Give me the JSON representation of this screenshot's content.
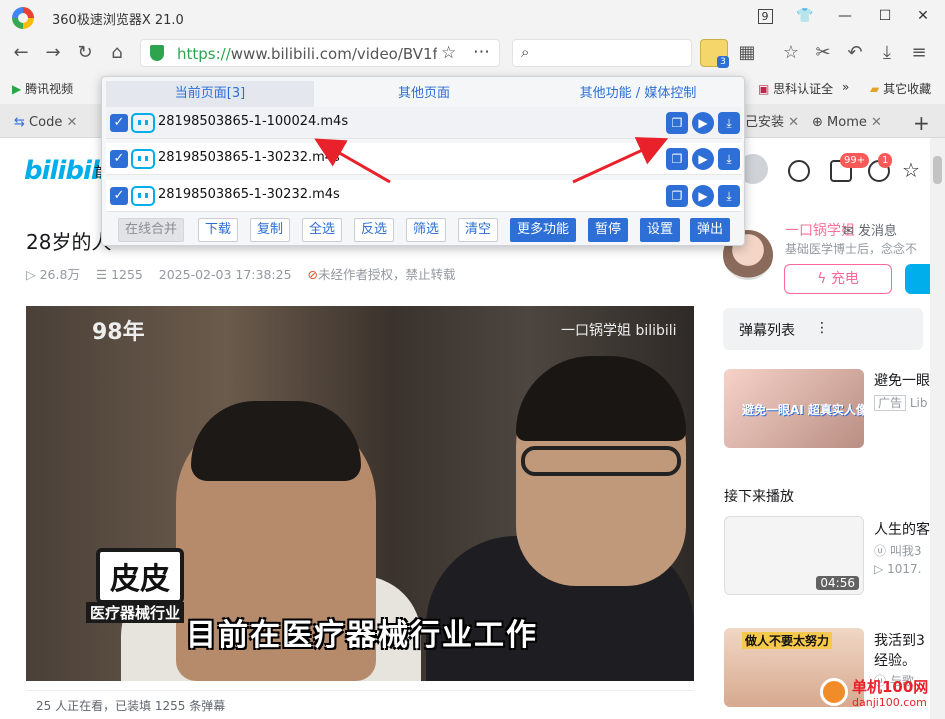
{
  "window": {
    "title": "360极速浏览器X 21.0",
    "controls": [
      "9",
      "⌂",
      "—",
      "☐",
      "✕"
    ]
  },
  "navbar": {
    "url_scheme": "https://",
    "url_rest": "www.bilibili.com/video/BV1ffPf",
    "extension_badge": "3"
  },
  "bookmarks": {
    "left": "腾讯视频",
    "item2": "思科认证全",
    "more": "»",
    "folder": "其它收藏"
  },
  "tabs": [
    {
      "label": "Code"
    },
    {
      "label": "己安装"
    },
    {
      "label": "Mome"
    }
  ],
  "page": {
    "logo": "bilibili",
    "nav_partial": "首",
    "video_title": "28岁的人",
    "title_tail": "一",
    "views": "26.8万",
    "danmaku_count": "1255",
    "date": "2025-02-03 17:38:25",
    "copyright": "未经作者授权，禁止转载",
    "video": {
      "year_overlay": "98年",
      "watermark": "一口锅学姐 bilibili",
      "name_tag": "皮皮",
      "job_tag": "医疗器械行业",
      "subtitle": "目前在医疗器械行业工作"
    },
    "header_badges": {
      "messages": "99+",
      "dynamics": "1"
    },
    "uploader": {
      "name": "一口锅学姐",
      "message": "发消息",
      "desc": "基础医学博士后，念念不",
      "charge": "充电"
    },
    "danmaku_list": {
      "title": "弹幕列表",
      "menu": "⋮"
    },
    "ad": {
      "title": "避免一眼",
      "tag": "广告",
      "source": "Lib",
      "thumb_text": "避免一眼AI 超真实人像"
    },
    "next_label": "接下来播放",
    "recommendations": [
      {
        "title": "人生的客",
        "up": "叫我3",
        "plays": "1017.",
        "duration": "04:56"
      },
      {
        "title": "我活到3",
        "line2": "经验。",
        "up": "与歌",
        "duration": "",
        "thumb_text": "做人不要太努力"
      }
    ],
    "danmaku_bar": "25 人正在看，已装填 1255 条弹幕"
  },
  "popup": {
    "tabs": [
      "当前页面[3]",
      "其他页面",
      "其他功能 / 媒体控制"
    ],
    "files": [
      {
        "name": "28198503865-1-100024.m4s"
      },
      {
        "name": "28198503865-1-30232.m4s"
      },
      {
        "name": "28198503865-1-30232.m4s"
      }
    ],
    "buttons": [
      "在线合并",
      "下载",
      "复制",
      "全选",
      "反选",
      "筛选",
      "清空",
      "更多功能",
      "暂停",
      "设置",
      "弹出"
    ]
  },
  "watermark_site": "单机100网",
  "watermark_domain": "danji100.com",
  "colors": {
    "accent": "#2d6fd6",
    "bili_blue": "#00aeec",
    "bili_pink": "#fb7299",
    "arrow": "#e8212b"
  }
}
